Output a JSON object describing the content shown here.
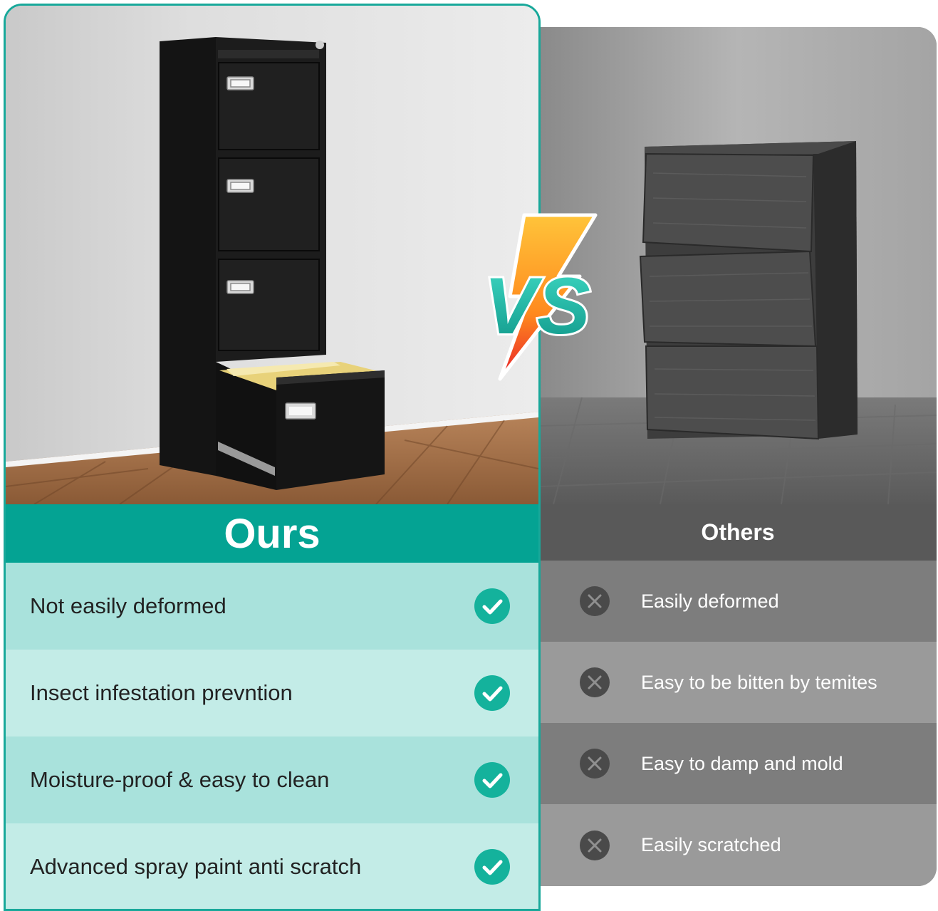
{
  "ours": {
    "title": "Ours",
    "features": [
      {
        "label": "Not easily deformed"
      },
      {
        "label": "Insect infestation prevntion"
      },
      {
        "label": "Moisture-proof & easy to clean"
      },
      {
        "label": "Advanced spray paint anti scratch"
      }
    ]
  },
  "others": {
    "title": "Others",
    "features": [
      {
        "label": "Easily deformed"
      },
      {
        "label": "Easy to be bitten by temites"
      },
      {
        "label": "Easy to damp and mold"
      },
      {
        "label": "Easily scratched"
      }
    ]
  },
  "vs": {
    "text": "VS"
  },
  "icons": {
    "ours_row": "check-circle-icon",
    "others_row": "x-circle-icon"
  },
  "colors": {
    "ours_accent": "#04a393",
    "ours_row_dark": "#a9e2dc",
    "ours_row_light": "#c3ece7",
    "check_green": "#14b29c",
    "others_header": "#595959",
    "others_row_dark": "#7d7d7d",
    "others_row_light": "#9a9a9a"
  }
}
